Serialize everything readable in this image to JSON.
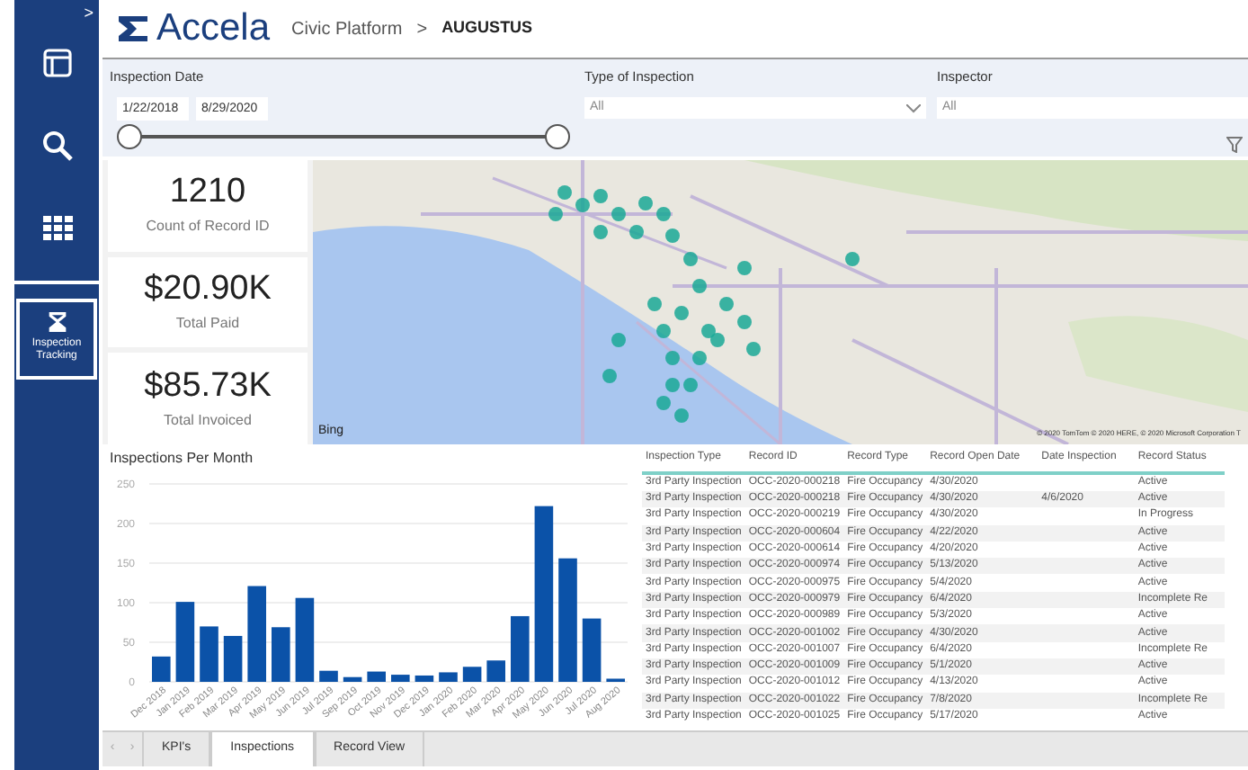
{
  "header": {
    "logo": "Accela",
    "breadcrumb": "Civic Platform",
    "separator": ">",
    "current": "AUGUSTUS"
  },
  "sidebar": {
    "expand": ">",
    "items": [
      {
        "kind": "layout",
        "selected": false
      },
      {
        "kind": "search",
        "selected": false
      },
      {
        "kind": "grid",
        "selected": false
      },
      {
        "kind": "tracking",
        "label": "Inspection Tracking",
        "selected": true
      }
    ]
  },
  "filters": {
    "date": {
      "label": "Inspection Date",
      "from": "1/22/2018",
      "to": "8/29/2020",
      "start_thumb": {
        "level": 0
      },
      "end_thumb": {
        "level": 1
      }
    },
    "type": {
      "label": "Type of Inspection",
      "value": "All"
    },
    "inspector": {
      "label": "Inspector",
      "value": "All"
    }
  },
  "kpis": [
    {
      "value": "1210",
      "label": "Count of Record ID"
    },
    {
      "value": "$20.90K",
      "label": "Total Paid"
    },
    {
      "value": "$85.73K",
      "label": "Total Invoiced"
    }
  ],
  "map": {
    "brand": "Bing",
    "copyright": "© 2020 TomTom © 2020 HERE, © 2020 Microsoft Corporation T"
  },
  "chart": {
    "chart_data": {
      "type": "bar",
      "title": "Inspections Per Month",
      "categories": [
        "Dec 2018",
        "Jan 2019",
        "Feb 2019",
        "Mar 2019",
        "Apr 2019",
        "May 2019",
        "Jun 2019",
        "Jul 2019",
        "Sep 2019",
        "Oct 2019",
        "Nov 2019",
        "Dec 2019",
        "Jan 2020",
        "Feb 2020",
        "Mar 2020",
        "Apr 2020",
        "May 2020",
        "Jun 2020",
        "Jul 2020",
        "Aug 2020"
      ],
      "series": [
        {
          "color": "#0b52a8",
          "values": [
            32,
            101,
            70,
            58,
            121,
            69,
            106,
            14,
            6,
            13,
            9,
            8,
            12,
            19,
            27,
            83,
            222,
            156,
            80,
            4
          ]
        }
      ],
      "ylim": [
        0,
        250
      ],
      "grid": true,
      "yticks": [
        0,
        50,
        100,
        150,
        200,
        250
      ]
    }
  },
  "table": {
    "columns": [
      "Inspection Type",
      "Record ID",
      "Record Type",
      "Record Open Date",
      "Date Inspection",
      "Record Status"
    ],
    "rows": [
      [
        "3rd Party Inspection",
        "OCC-2020-000218",
        "Fire Occupancy",
        "4/30/2020",
        "",
        "Active"
      ],
      [
        "3rd Party Inspection",
        "OCC-2020-000218",
        "Fire Occupancy",
        "4/30/2020",
        "4/6/2020",
        "Active"
      ],
      [
        "3rd Party Inspection",
        "OCC-2020-000219",
        "Fire Occupancy",
        "4/30/2020",
        "",
        "In Progress"
      ],
      [
        "3rd Party Inspection",
        "OCC-2020-000604",
        "Fire Occupancy",
        "4/22/2020",
        "",
        "Active"
      ],
      [
        "3rd Party Inspection",
        "OCC-2020-000614",
        "Fire Occupancy",
        "4/20/2020",
        "",
        "Active"
      ],
      [
        "3rd Party Inspection",
        "OCC-2020-000974",
        "Fire Occupancy",
        "5/13/2020",
        "",
        "Active"
      ],
      [
        "3rd Party Inspection",
        "OCC-2020-000975",
        "Fire Occupancy",
        "5/4/2020",
        "",
        "Active"
      ],
      [
        "3rd Party Inspection",
        "OCC-2020-000979",
        "Fire Occupancy",
        "6/4/2020",
        "",
        "Incomplete Re"
      ],
      [
        "3rd Party Inspection",
        "OCC-2020-000989",
        "Fire Occupancy",
        "5/3/2020",
        "",
        "Active"
      ],
      [
        "3rd Party Inspection",
        "OCC-2020-001002",
        "Fire Occupancy",
        "4/30/2020",
        "",
        "Active"
      ],
      [
        "3rd Party Inspection",
        "OCC-2020-001007",
        "Fire Occupancy",
        "6/4/2020",
        "",
        "Incomplete Re"
      ],
      [
        "3rd Party Inspection",
        "OCC-2020-001009",
        "Fire Occupancy",
        "5/1/2020",
        "",
        "Active"
      ],
      [
        "3rd Party Inspection",
        "OCC-2020-001012",
        "Fire Occupancy",
        "4/13/2020",
        "",
        "Active"
      ],
      [
        "3rd Party Inspection",
        "OCC-2020-001022",
        "Fire Occupancy",
        "7/8/2020",
        "",
        "Incomplete Re"
      ],
      [
        "3rd Party Inspection",
        "OCC-2020-001025",
        "Fire Occupancy",
        "5/17/2020",
        "",
        "Active"
      ]
    ]
  },
  "tab_nav": {
    "previous": "‹",
    "next": "›"
  },
  "tabs": [
    {
      "label": "KPI's",
      "selected": false
    },
    {
      "label": "Inspections",
      "selected": true
    },
    {
      "label": "Record View",
      "selected": false
    }
  ]
}
